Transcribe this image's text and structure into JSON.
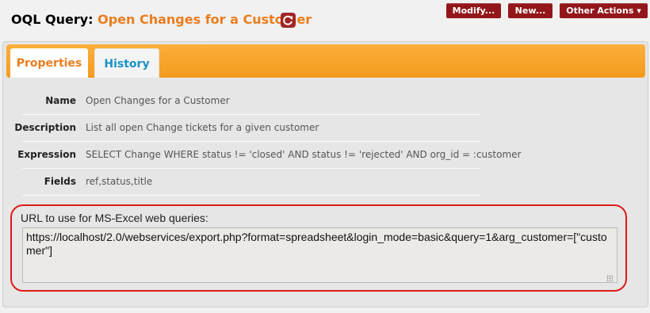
{
  "header": {
    "title_prefix": "OQL Query: ",
    "title_name": "Open Changes for a Customer",
    "refresh_icon": "refresh-icon",
    "buttons": {
      "modify": "Modify...",
      "new": "New...",
      "other_actions": "Other Actions",
      "other_actions_caret": "▼"
    }
  },
  "tabs": [
    {
      "label": "Properties",
      "active": true
    },
    {
      "label": "History",
      "active": false
    }
  ],
  "properties": [
    {
      "label": "Name",
      "value": "Open Changes for a Customer"
    },
    {
      "label": "Description",
      "value": "List all open Change tickets for a given customer"
    },
    {
      "label": "Expression",
      "value": "SELECT Change WHERE status != 'closed' AND status != 'rejected' AND org_id = :customer"
    },
    {
      "label": "Fields",
      "value": "ref,status,title"
    }
  ],
  "excel": {
    "label": "URL to use for MS-Excel web queries:",
    "url": "https://localhost/2.0/webservices/export.php?format=spreadsheet&login_mode=basic&query=1&arg_customer=[\"customer\"]"
  },
  "colors": {
    "accent_orange": "#ea7d1e",
    "button_red": "#93161a",
    "history_blue": "#1a92c4",
    "highlight_red": "#e01a1a"
  }
}
